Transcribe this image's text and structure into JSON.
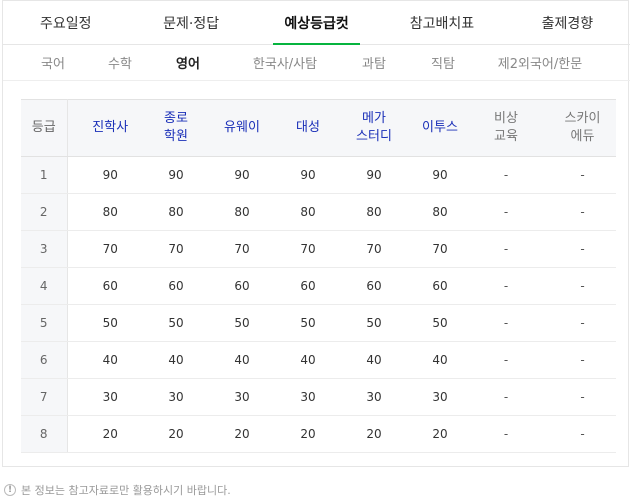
{
  "top_tabs": [
    {
      "label": "주요일정",
      "active": false
    },
    {
      "label": "문제·정답",
      "active": false
    },
    {
      "label": "예상등급컷",
      "active": true
    },
    {
      "label": "참고배치표",
      "active": false
    },
    {
      "label": "출제경향",
      "active": false
    }
  ],
  "subject_tabs": [
    {
      "label": "국어",
      "active": false
    },
    {
      "label": "수학",
      "active": false
    },
    {
      "label": "영어",
      "active": true
    },
    {
      "label": "한국사/사탐",
      "active": false
    },
    {
      "label": "과탐",
      "active": false
    },
    {
      "label": "직탐",
      "active": false
    },
    {
      "label": "제2외국어/한문",
      "active": false
    }
  ],
  "accent_color": "#06b43f",
  "table": {
    "grade_header": "등급",
    "providers": [
      {
        "line1": "진학사",
        "line2": ""
      },
      {
        "line1": "종로",
        "line2": "학원"
      },
      {
        "line1": "유웨이",
        "line2": ""
      },
      {
        "line1": "대성",
        "line2": ""
      },
      {
        "line1": "메가",
        "line2": "스터디"
      },
      {
        "line1": "이투스",
        "line2": ""
      },
      {
        "line1": "비상",
        "line2": "교육"
      },
      {
        "line1": "스카이",
        "line2": "에듀"
      }
    ],
    "rows": [
      {
        "grade": "1",
        "values": [
          "90",
          "90",
          "90",
          "90",
          "90",
          "90",
          "-",
          "-"
        ]
      },
      {
        "grade": "2",
        "values": [
          "80",
          "80",
          "80",
          "80",
          "80",
          "80",
          "-",
          "-"
        ]
      },
      {
        "grade": "3",
        "values": [
          "70",
          "70",
          "70",
          "70",
          "70",
          "70",
          "-",
          "-"
        ]
      },
      {
        "grade": "4",
        "values": [
          "60",
          "60",
          "60",
          "60",
          "60",
          "60",
          "-",
          "-"
        ]
      },
      {
        "grade": "5",
        "values": [
          "50",
          "50",
          "50",
          "50",
          "50",
          "50",
          "-",
          "-"
        ]
      },
      {
        "grade": "6",
        "values": [
          "40",
          "40",
          "40",
          "40",
          "40",
          "40",
          "-",
          "-"
        ]
      },
      {
        "grade": "7",
        "values": [
          "30",
          "30",
          "30",
          "30",
          "30",
          "30",
          "-",
          "-"
        ]
      },
      {
        "grade": "8",
        "values": [
          "20",
          "20",
          "20",
          "20",
          "20",
          "20",
          "-",
          "-"
        ]
      }
    ]
  },
  "footnote": {
    "icon": "info-circle-icon",
    "text": "본 정보는 참고자료로만 활용하시기 바랍니다."
  }
}
